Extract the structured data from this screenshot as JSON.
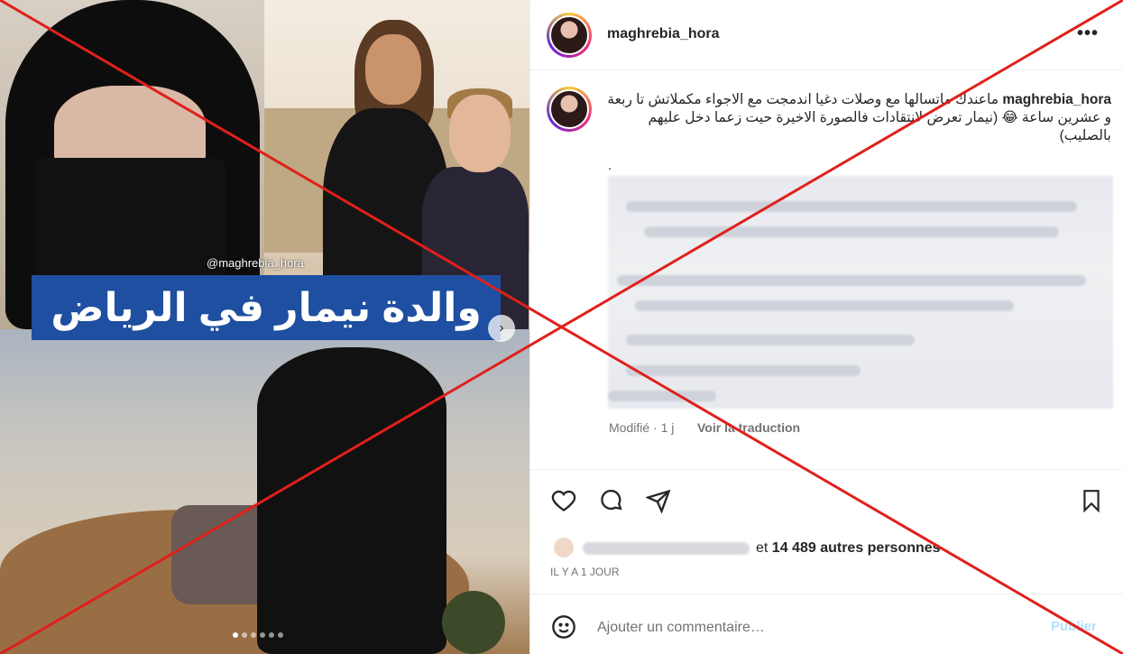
{
  "media": {
    "watermark": "@maghrebia_hora",
    "overlay_title": "والدة نيمار في الرياض",
    "next_icon": "chevron-right-icon",
    "carousel_count": 6,
    "carousel_active": 1
  },
  "header": {
    "username": "maghrebia_hora",
    "more_icon": "more-horizontal-icon",
    "more_label": "•••"
  },
  "caption": {
    "username": "maghrebia_hora",
    "text": "ماعندك ماتسالها مع وصلات دغيا اندمجت مع الاجواء مكملاتش تا ربعة و عشرين ساعة 😂 (نيمار تعرض لانتقادات فالصورة الاخيرة حيت زعما دخل عليهم بالصليب)",
    "dot": ".",
    "meta": "Modifié · 1 j",
    "translate": "Voir la traduction"
  },
  "actions": {
    "like_icon": "heart-icon",
    "comment_icon": "comment-icon",
    "share_icon": "send-icon",
    "save_icon": "bookmark-icon"
  },
  "likes": {
    "prefix": "et",
    "count": "14 489",
    "suffix": "autres personnes"
  },
  "time": "IL Y A 1 JOUR",
  "comment": {
    "placeholder": "Ajouter un commentaire…",
    "emoji_icon": "smiley-icon",
    "publish": "Publier"
  },
  "colors": {
    "cross": "#e0201b",
    "overlay_bg": "#1e4fa0",
    "link_blue": "#b2dffc"
  }
}
